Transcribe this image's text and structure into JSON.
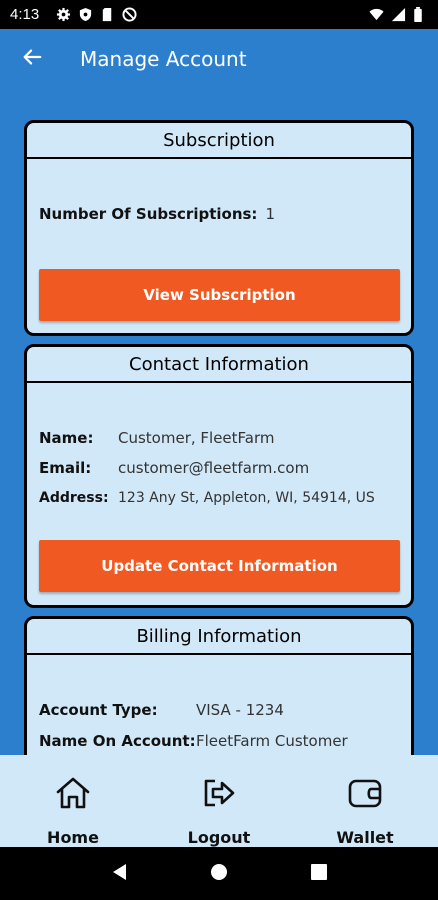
{
  "status": {
    "time": "4:13"
  },
  "header": {
    "title": "Manage Account"
  },
  "subscription": {
    "title": "Subscription",
    "count_label": "Number Of Subscriptions:",
    "count_value": "1",
    "button": "View Subscription"
  },
  "contact": {
    "title": "Contact Information",
    "rows": [
      {
        "label": "Name:",
        "value": "Customer, FleetFarm"
      },
      {
        "label": "Email:",
        "value": "customer@fleetfarm.com"
      },
      {
        "label": "Address:",
        "value": "123 Any St, Appleton, WI, 54914, US"
      }
    ],
    "button": "Update Contact Information"
  },
  "billing": {
    "title": "Billing Information",
    "rows": [
      {
        "label": "Account Type:",
        "value": "VISA - 1234"
      },
      {
        "label": "Name On Account:",
        "value": "FleetFarm Customer"
      }
    ]
  },
  "bottom_nav": {
    "items": [
      {
        "label": "Home",
        "icon": "home-icon"
      },
      {
        "label": "Logout",
        "icon": "logout-icon"
      },
      {
        "label": "Wallet",
        "icon": "wallet-icon"
      }
    ]
  },
  "colors": {
    "primary": "#2c7fcc",
    "card": "#d1e8f8",
    "accent": "#f05a22"
  }
}
